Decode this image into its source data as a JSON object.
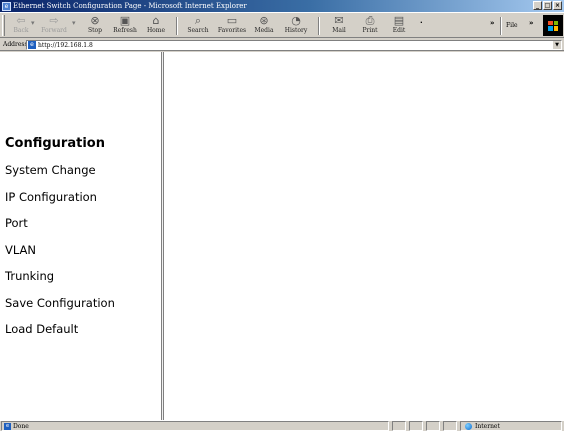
{
  "window": {
    "title": "Ethernet Switch Configuration Page - Microsoft Internet Explorer",
    "buttons": {
      "minimize": "_",
      "maximize": "□",
      "close": "×"
    }
  },
  "toolbar": {
    "back": "Back",
    "forward": "Forward",
    "stop": "Stop",
    "refresh": "Refresh",
    "home": "Home",
    "search": "Search",
    "favorites": "Favorites",
    "media": "Media",
    "history": "History",
    "mail": "Mail",
    "print": "Print",
    "edit": "Edit",
    "overflow": "»",
    "menu_file": "File"
  },
  "address": {
    "label": "Address",
    "url": "http://192.168.1.8"
  },
  "nav": {
    "heading": "Configuration",
    "items": [
      "System Change",
      "IP Configuration",
      "Port",
      "VLAN",
      "Trunking",
      "Save Configuration",
      "Load Default"
    ]
  },
  "status": {
    "text": "Done",
    "zone": "Internet"
  }
}
